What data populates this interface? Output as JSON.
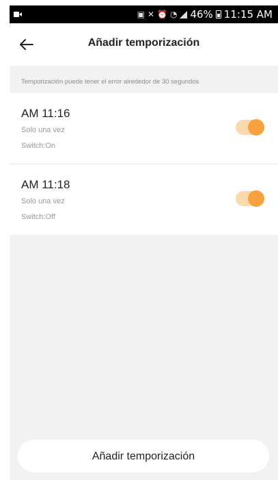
{
  "status_bar": {
    "battery_percent": "46%",
    "time": "11:15 AM"
  },
  "header": {
    "title": "Añadir temporización"
  },
  "notice": {
    "text": "Temporización puede tener el error alrededor de 30 segundos"
  },
  "timers": [
    {
      "time": "AM 11:16",
      "repeat": "Solo una vez",
      "action": "Switch:On",
      "enabled": true
    },
    {
      "time": "AM 11:18",
      "repeat": "Solo una vez",
      "action": "Switch:Off",
      "enabled": true
    }
  ],
  "footer": {
    "add_button_label": "Añadir temporización"
  },
  "colors": {
    "accent": "#f7a23e",
    "toggle_track": "#fbd9ae",
    "background": "#f2f2f2"
  }
}
